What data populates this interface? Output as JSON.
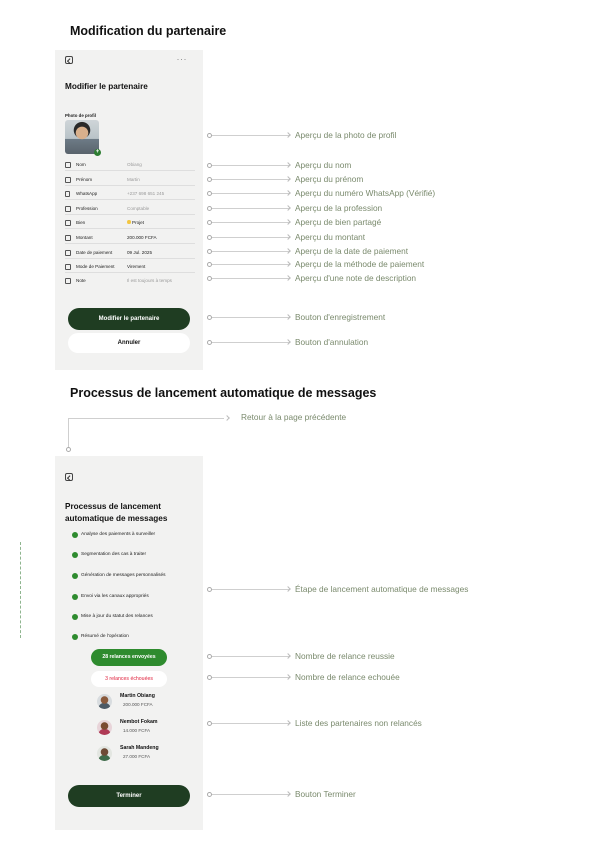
{
  "section1": {
    "title": "Modification du partenaire",
    "screen": {
      "more": "···",
      "title": "Modifier le partenaire",
      "photo_label": "Photo de profil",
      "fields": [
        {
          "icon": "id-card-icon",
          "label": "Nom",
          "value": "Obiang"
        },
        {
          "icon": "id-card-icon",
          "label": "Prénom",
          "value": "Martin"
        },
        {
          "icon": "phone-icon",
          "label": "WhatsApp",
          "value": "+237 698 651 245"
        },
        {
          "icon": "briefcase-icon",
          "label": "Profession",
          "value": "Comptable"
        },
        {
          "icon": "house-icon",
          "label": "Bien",
          "value": "Projet"
        },
        {
          "icon": "wallet-icon",
          "label": "Montant",
          "value": "200.000 FCFA"
        },
        {
          "icon": "calendar-icon",
          "label": "Date de paiement",
          "value": "09 Jul. 2025"
        },
        {
          "icon": "payment-method-icon",
          "label": "Mode de Paiement",
          "value": "Virement"
        },
        {
          "icon": "note-icon",
          "label": "Note",
          "value": "Il est toujours à temps"
        }
      ],
      "save_button": "Modifier le partenaire",
      "cancel_button": "Annuler"
    },
    "annotations": [
      "Aperçu de la photo de profil",
      "Aperçu du nom",
      "Aperçu du prénom",
      "Aperçu du numéro WhatsApp (Vérifié)",
      "Aperçu de la profession",
      "Aperçu de bien partagé",
      "Aperçu du montant",
      "Aperçu de la date de paiement",
      "Aperçu de la méthode de paiement",
      "Aperçu d'une note de description",
      "Bouton d'enregistrement",
      "Bouton d'annulation"
    ]
  },
  "section2": {
    "title": "Processus de lancement automatique de messages",
    "return_annotation": "Retour à la page précédente",
    "screen": {
      "title_line1": "Processus de lancement",
      "title_line2": "automatique de messages",
      "steps": [
        "Analyse des paiements à surveiller",
        "Segmentation des cas à traiter",
        "Génération de messages personnalisés",
        "Envoi via les canaux appropriés",
        "Mise à jour du statut des relances",
        "Résumé de l'opération"
      ],
      "success_pill": "28 relances envoyées",
      "failed_pill": "3 relances échouées",
      "partners": [
        {
          "name": "Martin Obiang",
          "amount": "200.000 FCFA"
        },
        {
          "name": "Nembot Fokam",
          "amount": "14.000 FCFA"
        },
        {
          "name": "Sarah Mandeng",
          "amount": "27.000 FCFA"
        }
      ],
      "finish_button": "Terminer"
    },
    "annotations": [
      "Étape de lancement automatique de messages",
      "Nombre de relance reussie",
      "Nombre de relance echouée",
      "Liste des partenaires non relancés",
      "Bouton Terminer"
    ]
  },
  "colors": {
    "primary_button": "#1f3d22",
    "success_green": "#2e8b2e",
    "failure_red": "#e0223d",
    "annotation_text": "#7a8a6d",
    "screen_background": "#f2f2f1"
  }
}
